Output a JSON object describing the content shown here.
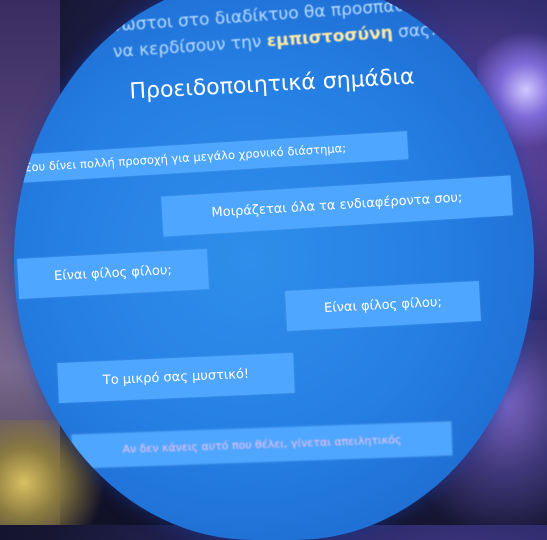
{
  "slide": {
    "intro_line1": "Άγνωστοι στο διαδίκτυο θα προσπαθήσουν",
    "intro_line2_pre": "να κερδίσουν την ",
    "intro_highlight": "εμπιστοσύνη",
    "intro_line2_post": " σας!",
    "heading": "Προειδοποιητικά σημάδια",
    "signs": [
      "Σου δίνει πολλή προσοχή για μεγάλο χρονικό διάστημα;",
      "Μοιράζεται όλα τα ενδιαφέροντα σου;",
      "Είναι φίλος φίλου;",
      "Είναι φίλος φίλου;",
      "Το μικρό σας μυστικό!",
      "Αν δεν κάνεις αυτό που θέλει, γίνεται απειλητικός"
    ]
  }
}
